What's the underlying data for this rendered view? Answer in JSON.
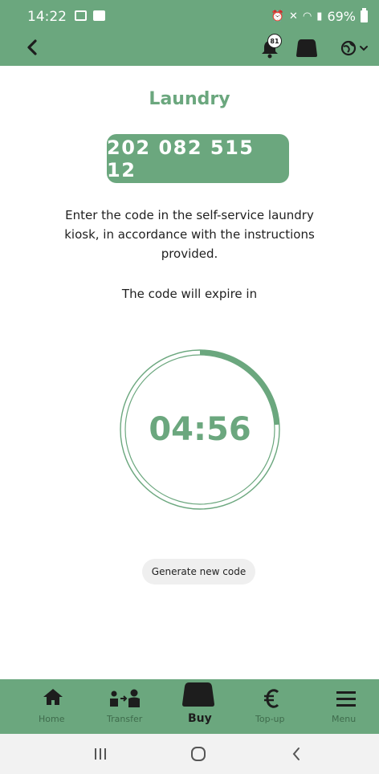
{
  "status_bar": {
    "time": "14:22",
    "battery_percent": "69%"
  },
  "header": {
    "notification_count": "81"
  },
  "main": {
    "title": "Laundry",
    "code": "202 082 515 12",
    "instructions": "Enter the code in the self-service laundry kiosk, in accordance with the instructions provided.",
    "expire_label": "The code will expire in",
    "timer": "04:56",
    "timer_progress": 0.24,
    "generate_button": "Generate new code"
  },
  "bottom_nav": {
    "items": [
      {
        "label": "Home",
        "icon": "home-icon"
      },
      {
        "label": "Transfer",
        "icon": "transfer-icon"
      },
      {
        "label": "Buy",
        "icon": "buy-machine-icon",
        "active": true
      },
      {
        "label": "Top-up",
        "icon": "euro-icon"
      },
      {
        "label": "Menu",
        "icon": "menu-icon"
      }
    ]
  },
  "colors": {
    "accent": "#6ba77e",
    "nav_label": "#3f6b4c",
    "button_bg": "#efefef"
  }
}
